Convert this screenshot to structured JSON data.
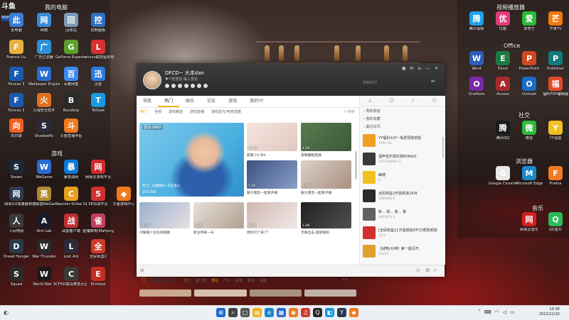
{
  "desktop": {
    "groups": {
      "my_computer": "我的电脑",
      "games": "游戏",
      "video_player": "视频播放器",
      "office": "Office",
      "social": "社交",
      "browser": "浏览器",
      "music": "音乐"
    },
    "left_icons": [
      {
        "label": "此电脑",
        "icon": "computer-icon",
        "color": "#3a7bd5"
      },
      {
        "label": "网络",
        "icon": "network-icon",
        "color": "#3a8ad5"
      },
      {
        "label": "回收站",
        "icon": "recycle-bin-icon",
        "color": "#7a9ab5"
      },
      {
        "label": "控制面板",
        "icon": "control-panel-icon",
        "color": "#2f6fc0"
      },
      {
        "label": "Francis Liu",
        "icon": "user-folder-icon",
        "color": "#e8b040"
      },
      {
        "label": "广告过滤器",
        "icon": "adblock-icon",
        "color": "#2c8fd8"
      },
      {
        "label": "GeForce Experience",
        "icon": "geforce-icon",
        "color": "#5aa02c"
      },
      {
        "label": "Lenovo联想驱动管理",
        "icon": "lenovo-icon",
        "color": "#d83030"
      },
      {
        "label": "Fences 3",
        "icon": "fences-icon",
        "color": "#1a5ab0"
      },
      {
        "label": "Wallpaper Engine",
        "icon": "wallpaper-engine-icon",
        "color": "#2a6bd0"
      },
      {
        "label": "百度网盘",
        "icon": "baidu-netdisk-icon",
        "color": "#3a8af0"
      },
      {
        "label": "迅雷",
        "icon": "xunlei-icon",
        "color": "#2a7ae0"
      },
      {
        "label": "Fences 3",
        "icon": "fences-icon",
        "color": "#1a5ab0"
      },
      {
        "label": "火绒安全软件",
        "icon": "huorong-icon",
        "color": "#e07020"
      },
      {
        "label": "Bandizip",
        "icon": "bandizip-icon",
        "color": "#2a2a2a"
      },
      {
        "label": "ToDesk",
        "icon": "todesk-icon",
        "color": "#1a9ae0"
      },
      {
        "label": "向日葵",
        "icon": "sunlogin-icon",
        "color": "#f06020"
      },
      {
        "label": "Shadowfly",
        "icon": "shadowfly-icon",
        "color": "#2a2a3a"
      },
      {
        "label": "斗鱼直播伴侣",
        "icon": "douyu-icon",
        "color": "#f07a20"
      },
      {
        "label": "Steam",
        "icon": "steam-icon",
        "color": "#1b2838"
      },
      {
        "label": "WeGame",
        "icon": "wegame-icon",
        "color": "#2a6ad0"
      },
      {
        "label": "暴雪战网",
        "icon": "battlenet-icon",
        "color": "#0a7ad8"
      },
      {
        "label": "网易云游戏平台",
        "icon": "netease-cloud-game-icon",
        "color": "#d02a2a"
      },
      {
        "label": "网易UU加速器",
        "icon": "uu-accelerator-icon",
        "color": "#2a3a50"
      },
      {
        "label": "英雄联盟WeGame版",
        "icon": "lol-icon",
        "color": "#b08a30"
      },
      {
        "label": "Counter-Strike Global Off...",
        "icon": "csgo-icon",
        "color": "#e8a020"
      },
      {
        "label": "5E对战平台",
        "icon": "5e-icon",
        "color": "#d03030"
      },
      {
        "label": "人间地狱",
        "icon": "hell-let-loose-icon",
        "color": "#3a3a3a"
      },
      {
        "label": "Aim Lab",
        "icon": "aimlab-icon",
        "color": "#1a1a2a"
      },
      {
        "label": "战雷客户端",
        "icon": "war-thunder-client-icon",
        "color": "#c03030"
      },
      {
        "label": "雀魂麻将(Mahjong...)",
        "icon": "mahjong-soul-icon",
        "color": "#c04060"
      },
      {
        "label": "Dread Hunger",
        "icon": "dread-hunger-icon",
        "color": "#2a3a4a"
      },
      {
        "label": "War Thunder",
        "icon": "war-thunder-icon",
        "color": "#2a2a2a"
      },
      {
        "label": "Lost Ark",
        "icon": "lost-ark-icon",
        "color": "#2a2a3a"
      },
      {
        "label": "全民街篮2",
        "icon": "street-basketball-icon",
        "color": "#d03a2a"
      },
      {
        "label": "Squad",
        "icon": "squad-icon",
        "color": "#2a2a2a"
      },
      {
        "label": "World War 3",
        "icon": "world-war-3-icon",
        "color": "#1a1a1a"
      },
      {
        "label": "CFHD高清竞技大区",
        "icon": "cfhd-icon",
        "color": "#3a3a3a"
      },
      {
        "label": "Enlisted",
        "icon": "enlisted-icon",
        "color": "#c03020"
      }
    ],
    "mid_icon": {
      "label": "斗鱼游戏中心",
      "icon": "douyu-game-center-icon",
      "color": "#f07a20"
    },
    "right_icons": [
      {
        "label": "腾讯视频",
        "icon": "tencent-video-icon",
        "color": "#20a0e8"
      },
      {
        "label": "优酷",
        "icon": "youku-icon",
        "color": "#e03a7a"
      },
      {
        "label": "爱奇艺",
        "icon": "iqiyi-icon",
        "color": "#2aba3a"
      },
      {
        "label": "芒果TV",
        "icon": "mango-tv-icon",
        "color": "#f07a10"
      },
      {
        "label": "Word",
        "icon": "word-icon",
        "color": "#2b5fb8"
      },
      {
        "label": "Excel",
        "icon": "excel-icon",
        "color": "#1e7a44"
      },
      {
        "label": "PowerPoint",
        "icon": "powerpoint-icon",
        "color": "#d04a24"
      },
      {
        "label": "Publisher",
        "icon": "publisher-icon",
        "color": "#107a7a"
      },
      {
        "label": "OneNote",
        "icon": "onenote-icon",
        "color": "#7a2aa8"
      },
      {
        "label": "Access",
        "icon": "access-icon",
        "color": "#a82a2a"
      },
      {
        "label": "Outlook",
        "icon": "outlook-icon",
        "color": "#1a6ac8"
      },
      {
        "label": "福昕PDF编辑器",
        "icon": "foxit-pdf-icon",
        "color": "#e04a2a"
      },
      {
        "label": "腾讯QQ",
        "icon": "qq-icon",
        "color": "#1a1a1a"
      },
      {
        "label": "微信",
        "icon": "wechat-icon",
        "color": "#2aba3a"
      },
      {
        "label": "YY语音",
        "icon": "yy-voice-icon",
        "color": "#f0c020"
      },
      {
        "label": "Google Chrome",
        "icon": "chrome-icon",
        "color": "#e8e8e8"
      },
      {
        "label": "Microsoft Edge",
        "icon": "edge-icon",
        "color": "#1a8ac8"
      },
      {
        "label": "Firefox",
        "icon": "firefox-icon",
        "color": "#f07a20"
      },
      {
        "label": "网易云音乐",
        "icon": "netease-music-icon",
        "color": "#d02020"
      },
      {
        "label": "QQ音乐",
        "icon": "qq-music-icon",
        "color": "#2aba5a"
      }
    ]
  },
  "yy_window": {
    "user_name": "DFCD~ 大本dan",
    "signature": "♥个性签名:输入签名",
    "search_placeholder": "搜索房间",
    "nav_tabs": [
      "导航",
      "热门",
      "娱乐",
      "交友",
      "游戏",
      "我的YY"
    ],
    "active_nav": "热门",
    "sub_tabs": [
      "热门",
      "全部",
      "游戏精选",
      "游戏直播",
      "游戏星光/电竞直播"
    ],
    "refresh_label": "刷新",
    "big_card": {
      "tag": "原创·SPAD",
      "caption": "热门：主播精彩~点击进入",
      "count": "102.5W"
    },
    "thumbs": [
      {
        "caption": "甜美小1.9m",
        "count": "32.1W"
      },
      {
        "caption": "夜晚暖暖直播",
        "count": "4.5W"
      },
      {
        "caption": "跟大朋友一起看开播",
        "count": "7.4W"
      },
      {
        "caption": "跟大朋友一起看开播",
        "count": "3.1W"
      },
      {
        "caption": "闪耀美少女在线唱歌",
        "count": "10.2W"
      },
      {
        "caption": "新主持来一天",
        "count": "3.5W"
      },
      {
        "caption": "想你们了来了!",
        "count": "2.6W"
      },
      {
        "caption": "无限出击 超级唱响",
        "count": "1.3W"
      }
    ],
    "section": {
      "title": "娱乐表演",
      "tabs": [
        "音乐",
        "脱口秀",
        "舞蹈",
        "户外",
        "颜值",
        "颜值",
        "唱歌"
      ],
      "active_tab": "舞蹈"
    },
    "side": {
      "categories": [
        "我的频道",
        "我的收藏",
        "最近访问"
      ],
      "items": [
        {
          "title": "YY福利大厅~免费领取奖励",
          "sub": "3701.2w"
        },
        {
          "title": "语声音乐俱乐部KONGO",
          "sub": "1455184687  1"
        },
        {
          "title": "幽墙",
          "sub": "0"
        },
        {
          "title": "全民街篮2开黑频道26/8",
          "sub": "1669846  0"
        },
        {
          "title": "新...  新...  新...  第",
          "sub": "6800074  0"
        },
        {
          "title": "[全民街篮2] 开黑频道DFCD帮助频道",
          "sub": "13  0"
        },
        {
          "title": "【咸鸭/大神】第一首页开..",
          "sub": "1614  0"
        }
      ]
    }
  },
  "taskbar": {
    "time": "19:38",
    "date": "2022/11/16"
  }
}
